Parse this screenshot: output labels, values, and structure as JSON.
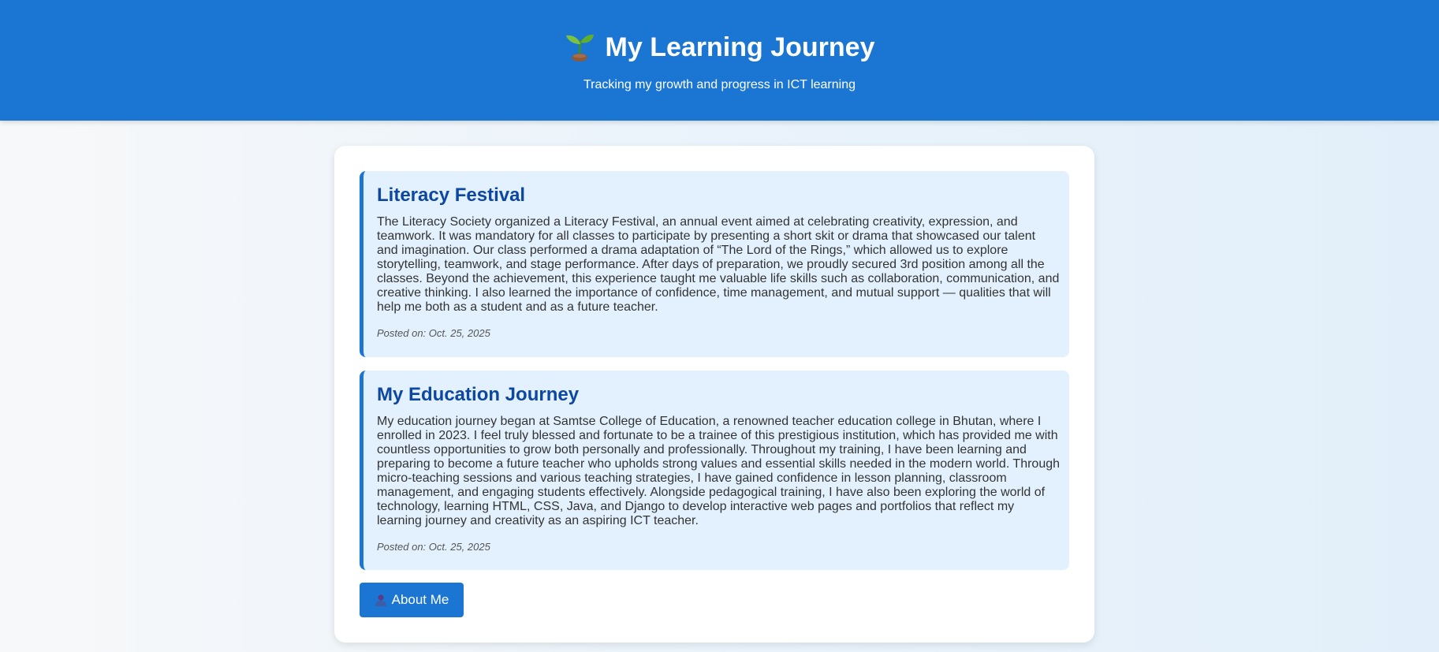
{
  "header": {
    "icon": "sprout-icon",
    "title": "My Learning Journey",
    "subtitle": "Tracking my growth and progress in ICT learning"
  },
  "posts": [
    {
      "title": "Literacy Festival",
      "body": "The Literacy Society organized a Literacy Festival, an annual event aimed at celebrating creativity, expression, and teamwork. It was mandatory for all classes to participate by presenting a short skit or drama that showcased our talent and imagination. Our class performed a drama adaptation of “The Lord of the Rings,” which allowed us to explore storytelling, teamwork, and stage performance. After days of preparation, we proudly secured 3rd position among all the classes. Beyond the achievement, this experience taught me valuable life skills such as collaboration, communication, and creative thinking. I also learned the importance of confidence, time management, and mutual support — qualities that will help me both as a student and as a future teacher.",
      "posted": "Posted on: Oct. 25, 2025"
    },
    {
      "title": "My Education Journey",
      "body": "My education journey began at Samtse College of Education, a renowned teacher education college in Bhutan, where I enrolled in 2023. I feel truly blessed and fortunate to be a trainee of this prestigious institution, which has provided me with countless opportunities to grow both personally and professionally. Throughout my training, I have been learning and preparing to become a future teacher who upholds strong values and essential skills needed in the modern world. Through micro-teaching sessions and various teaching strategies, I have gained confidence in lesson planning, classroom management, and engaging students effectively. Alongside pedagogical training, I have also been exploring the world of technology, learning HTML, CSS, Java, and Django to develop interactive web pages and portfolios that reflect my learning journey and creativity as an aspiring ICT teacher.",
      "posted": "Posted on: Oct. 25, 2025"
    }
  ],
  "about_button": {
    "icon": "person-icon",
    "label": "About Me"
  },
  "colors": {
    "header_bg": "#1a76d2",
    "post_bg": "#e2f1fd",
    "post_title": "#0d47a1",
    "accent": "#1a76d2"
  }
}
